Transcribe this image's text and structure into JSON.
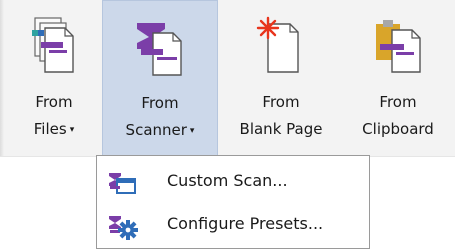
{
  "ribbon": {
    "buttons": [
      {
        "line1": "From",
        "line2": "Files",
        "has_dropdown": true,
        "icon": "files-icon"
      },
      {
        "line1": "From",
        "line2": "Scanner",
        "has_dropdown": true,
        "icon": "scanner-icon",
        "active": true
      },
      {
        "line1": "From",
        "line2": "Blank Page",
        "has_dropdown": false,
        "icon": "blank-page-icon"
      },
      {
        "line1": "From",
        "line2": "Clipboard",
        "has_dropdown": false,
        "icon": "clipboard-icon"
      }
    ],
    "caret": "▾"
  },
  "menu": {
    "items": [
      {
        "label": "Custom Scan...",
        "icon": "custom-scan-icon"
      },
      {
        "label": "Configure Presets...",
        "icon": "configure-presets-icon"
      }
    ]
  },
  "colors": {
    "active_bg": "#ccd8ea",
    "purple": "#7b3ea8",
    "blue": "#2f6db8",
    "red": "#e8341c",
    "gold": "#d9a52a"
  }
}
